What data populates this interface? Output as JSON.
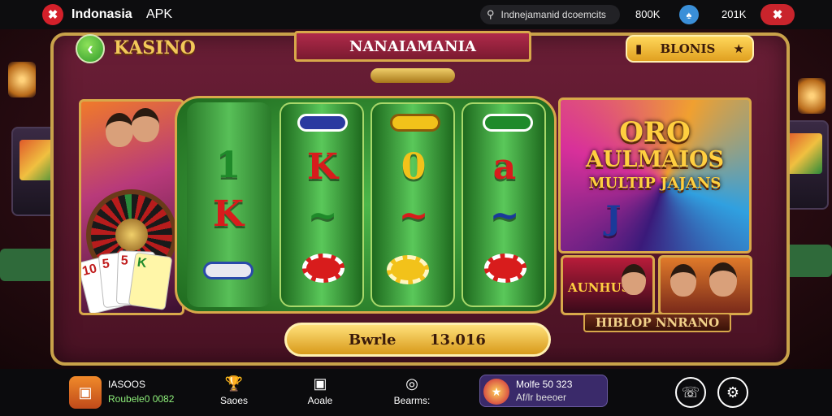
{
  "topbar": {
    "logo_glyph": "✖",
    "app_name": "Indonasia",
    "apk_label": "APK",
    "search_icon": "search-icon",
    "search_text": "Indnejamanid dcoemcits",
    "stat1": "800K",
    "blue_icon": "spade-icon",
    "stat2": "201K",
    "close_glyph": "✖"
  },
  "header": {
    "back_glyph": "‹",
    "title": "KASINO",
    "banner": "NANAIAMANIA",
    "bonus_label": "BLONIS",
    "bonus_left_icon": "ticket-icon",
    "bonus_right_icon": "star-icon"
  },
  "reels": {
    "col1": [
      "1",
      "K"
    ],
    "col2": [
      "K",
      "~"
    ],
    "col3": [
      "0",
      "~"
    ],
    "col4": [
      "a",
      "~"
    ],
    "extra": "J",
    "colors": {
      "red": "#d81c1c",
      "green": "#1f8a2a",
      "gold": "#f2c21a",
      "blue": "#1a3a9a"
    }
  },
  "cards": [
    "10",
    "5",
    "5",
    "K"
  ],
  "promo": {
    "line1": "ORO",
    "line2": "AULMAIOS",
    "line3": "MULTIP JAJANS",
    "sub1_text": "AUNHUS",
    "caption": "HIBLOP NNRANO"
  },
  "balance": {
    "label": "Bwrle",
    "value": "13.016"
  },
  "bottom": {
    "game_icon": "slot-icon",
    "game_name": "IASOOS",
    "game_sub": "Roubele0 0082",
    "nav": [
      {
        "label": "Saoes",
        "icon": "trophy-icon",
        "glyph": "🏆"
      },
      {
        "label": "Aoale",
        "icon": "slot-machine-icon",
        "glyph": "▣"
      },
      {
        "label": "Bearms:",
        "icon": "chat-icon",
        "glyph": "◎"
      }
    ],
    "promo_title": "Molfe 50 323",
    "promo_sub": "Af/lr beeoer",
    "support_glyph": "☏",
    "settings_glyph": "⚙"
  }
}
